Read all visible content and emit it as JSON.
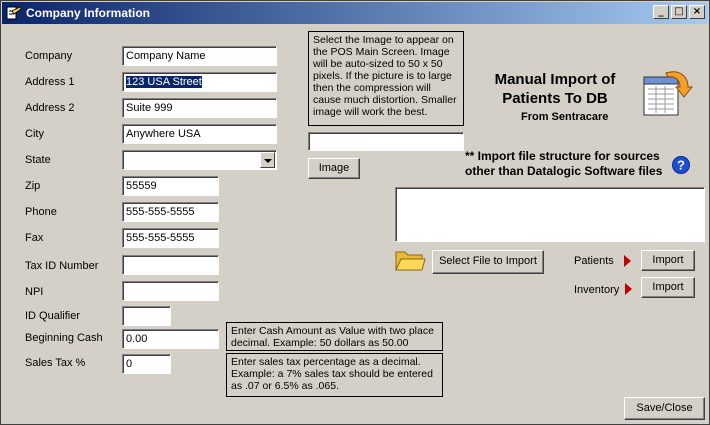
{
  "window": {
    "title": "Company Information"
  },
  "form": {
    "company": {
      "label": "Company",
      "value": "Company Name"
    },
    "address1": {
      "label": "Address 1",
      "value": "123 USA Street"
    },
    "address2": {
      "label": "Address 2",
      "value": "Suite 999"
    },
    "city": {
      "label": "City",
      "value": "Anywhere USA"
    },
    "state": {
      "label": "State",
      "value": ""
    },
    "zip": {
      "label": "Zip",
      "value": "55559"
    },
    "phone": {
      "label": "Phone",
      "value": "555-555-5555"
    },
    "fax": {
      "label": "Fax",
      "value": "555-555-5555"
    },
    "tax_id": {
      "label": "Tax ID Number",
      "value": ""
    },
    "npi": {
      "label": "NPI",
      "value": ""
    },
    "id_qualifier": {
      "label": "ID Qualifier",
      "value": ""
    },
    "beginning_cash": {
      "label": "Beginning Cash",
      "value": "0.00"
    },
    "sales_tax": {
      "label": "Sales Tax %",
      "value": "0"
    }
  },
  "notes": {
    "image_note": "Select the Image to appear on the POS Main Screen. Image will be auto-sized to 50 x 50 pixels. If the picture is to large then the compression will cause much distortion. Smaller image will work the best.",
    "cash_note": "Enter Cash Amount as Value with two place decimal. Example: 50 dollars as 50.00",
    "tax_note": "Enter sales tax percentage as a decimal. Example: a 7% sales tax should be entered as .07 or 6.5% as .065."
  },
  "image": {
    "path_value": "",
    "button_label": "Image"
  },
  "import": {
    "heading_line1": "Manual Import of",
    "heading_line2": "Patients To DB",
    "from": "From Sentracare",
    "structure_note_line1": "** Import file structure for sources",
    "structure_note_line2": "other than Datalogic Software files",
    "file_text": "",
    "select_file_label": "Select File to Import",
    "patients_label": "Patients",
    "inventory_label": "Inventory",
    "import_label": "Import"
  },
  "footer": {
    "save_close_label": "Save/Close"
  },
  "colors": {
    "title_start": "#0a246a",
    "title_end": "#a6caf0",
    "help_blue": "#1c4ed8",
    "arrow_red": "#c00000"
  }
}
